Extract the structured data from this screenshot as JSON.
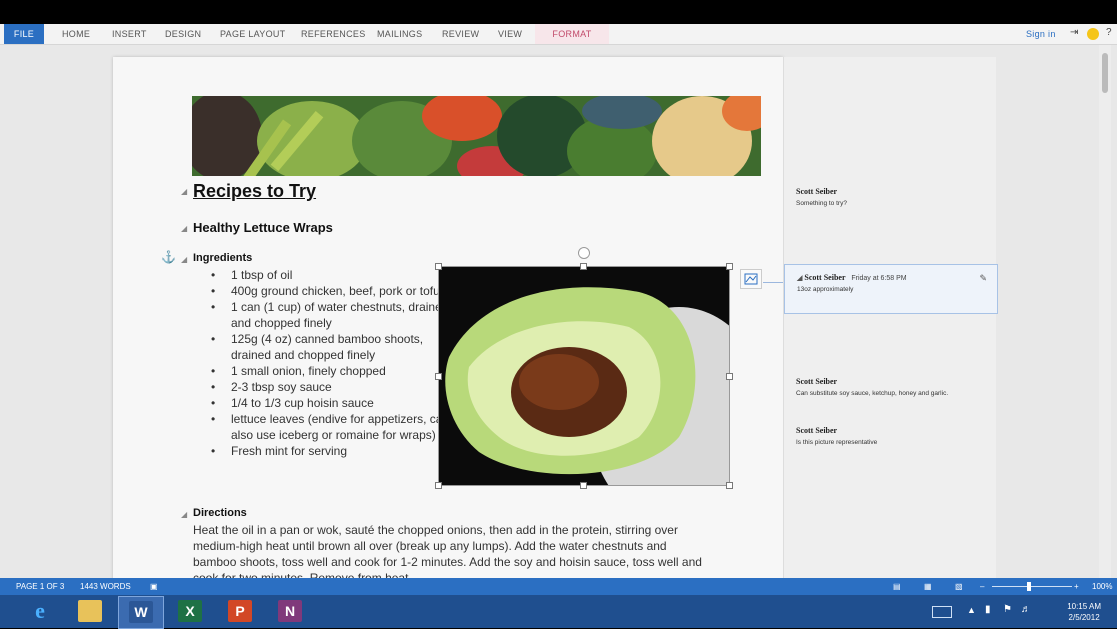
{
  "ribbon": {
    "tabs": [
      "HOME",
      "INSERT",
      "DESIGN",
      "PAGE LAYOUT",
      "REFERENCES",
      "MAILINGS",
      "REVIEW",
      "VIEW"
    ],
    "file_label": "FILE",
    "format_label": "FORMAT",
    "signin": "Sign in",
    "help": "?"
  },
  "document": {
    "title": "Recipes to Try",
    "recipe_title": "Healthy Lettuce Wraps",
    "ingredients_heading": "Ingredients",
    "ingredients": [
      "1 tbsp of oil",
      "400g ground chicken, beef, pork or tofu",
      "1 can (1 cup) of water chestnuts, drained and chopped finely",
      "125g (4 oz) canned bamboo shoots, drained and chopped finely",
      "1 small onion, finely chopped",
      "2-3 tbsp soy sauce",
      "1/4 to 1/3 cup hoisin sauce",
      "lettuce leaves (endive for appetizers, can also use iceberg or romaine for wraps)",
      "Fresh mint for serving"
    ],
    "directions_heading": "Directions",
    "directions": "Heat the oil in a pan or wok, sauté the chopped onions, then add in the protein, stirring over medium-high heat until brown all over (break up any lumps). Add the water chestnuts and bamboo shoots, toss well and cook for 1-2 minutes. Add the soy and hoisin sauce, toss well and cook for two minutes. Remove from heat."
  },
  "comments": [
    {
      "author": "Scott Seiber",
      "text": "Something to try?"
    },
    {
      "author": "Scott Seiber",
      "time": "Friday at 6:58 PM",
      "text": "13oz approximately"
    },
    {
      "author": "Scott Seiber",
      "text": "Can substitute soy sauce, ketchup, honey and garlic."
    },
    {
      "author": "Scott Seiber",
      "text": "Is this picture representative"
    }
  ],
  "status": {
    "page": "PAGE 1 OF 3",
    "words": "1443 WORDS",
    "zoom": "100%"
  },
  "taskbar": {
    "time": "10:15 AM",
    "date": "2/5/2012"
  },
  "colors": {
    "accent": "#2b6fc2",
    "format_tab": "#c24b6b",
    "taskbar": "#1f4f8f"
  }
}
